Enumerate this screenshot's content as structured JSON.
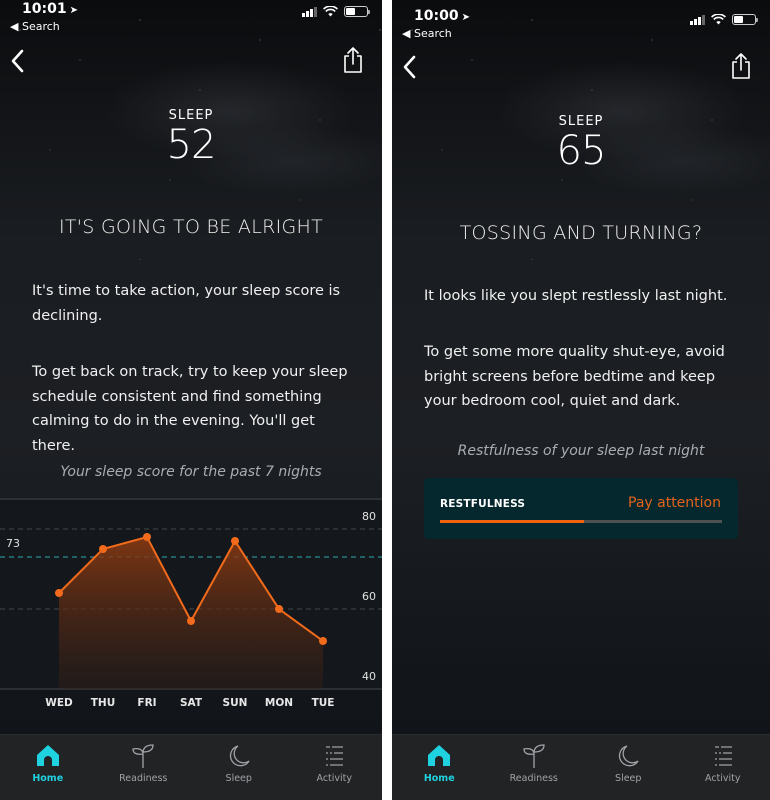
{
  "screens": [
    {
      "status": {
        "time": "10:01",
        "back_app": "◀ Search"
      },
      "hero": {
        "label": "SLEEP",
        "score": "52"
      },
      "headline": "IT'S GOING TO BE ALRIGHT",
      "paragraphs": [
        "It's time to take action, your sleep score is declining.",
        "To get back on track, try to keep your sleep schedule consistent and find something calming to do in the evening. You'll get there."
      ],
      "caption": "Your sleep score for the past 7 nights"
    },
    {
      "status": {
        "time": "10:00",
        "back_app": "◀ Search"
      },
      "hero": {
        "label": "SLEEP",
        "score": "65"
      },
      "headline": "TOSSING AND TURNING?",
      "paragraphs": [
        "It looks like you slept restlessly last night.",
        "To get some more quality shut-eye, avoid bright screens before bedtime and keep your bedroom cool, quiet and dark."
      ],
      "caption": "Restfulness of your sleep last night",
      "restfulness": {
        "label": "RESTFULNESS",
        "status": "Pay attention",
        "value_fraction": 0.51
      }
    }
  ],
  "tabbar": {
    "items": [
      {
        "label": "Home",
        "icon": "home-icon",
        "active": true
      },
      {
        "label": "Readiness",
        "icon": "sprout-icon",
        "active": false
      },
      {
        "label": "Sleep",
        "icon": "moon-icon",
        "active": false
      },
      {
        "label": "Activity",
        "icon": "activity-list-icon",
        "active": false
      }
    ]
  },
  "colors": {
    "accent": "#1fd2e0",
    "orange": "#f0620e",
    "average_line": "#2a8a90",
    "card_bg": "#05282e"
  },
  "chart_data": {
    "type": "area",
    "title": "Your sleep score for the past 7 nights",
    "categories": [
      "WED",
      "THU",
      "FRI",
      "SAT",
      "SUN",
      "MON",
      "TUE"
    ],
    "values": [
      64,
      75,
      78,
      57,
      77,
      60,
      52
    ],
    "average": 73,
    "average_label": "73",
    "yticks": [
      80,
      60,
      40
    ],
    "ylim": [
      40,
      87
    ],
    "grid": true,
    "xlabel": "",
    "ylabel": ""
  }
}
